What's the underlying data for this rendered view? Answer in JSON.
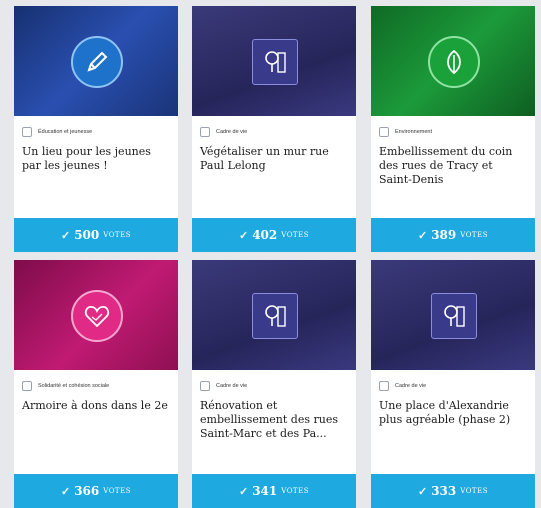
{
  "projects": [
    {
      "category": "Éducation et jeunesse",
      "title": "Un lieu pour les jeunes par les jeunes !",
      "votes": "500",
      "votes_label": "VOTES",
      "image": {
        "bg": "#1f3a8c",
        "accent": "#1f72c9",
        "icon": "pencil-icon"
      }
    },
    {
      "category": "Cadre de vie",
      "title": "Végétaliser un mur rue Paul Lelong",
      "votes": "402",
      "votes_label": "VOTES",
      "image": {
        "bg": "#2f2e6b",
        "accent": "#3a3a8a",
        "icon": "tree-building-icon"
      }
    },
    {
      "category": "Environnement",
      "title": "Embellissement du coin des rues de Tracy et Saint-Denis",
      "votes": "389",
      "votes_label": "VOTES",
      "image": {
        "bg": "#137a2c",
        "accent": "#1aa13a",
        "icon": "leaf-icon"
      }
    },
    {
      "category": "Solidarité et cohésion sociale",
      "title": "Armoire à dons dans le 2e",
      "votes": "366",
      "votes_label": "VOTES",
      "image": {
        "bg": "#a0145e",
        "accent": "#e02a86",
        "icon": "heart-handshake-icon"
      }
    },
    {
      "category": "Cadre de vie",
      "title": "Rénovation et embellissement des rues Saint-Marc et des Pa...",
      "votes": "341",
      "votes_label": "VOTES",
      "image": {
        "bg": "#2f2e6b",
        "accent": "#3a3a8a",
        "icon": "tree-building-icon"
      }
    },
    {
      "category": "Cadre de vie",
      "title": "Une place d'Alexandrie plus agréable (phase 2)",
      "votes": "333",
      "votes_label": "VOTES",
      "image": {
        "bg": "#2f2e6b",
        "accent": "#3a3a8a",
        "icon": "tree-building-icon"
      }
    }
  ]
}
